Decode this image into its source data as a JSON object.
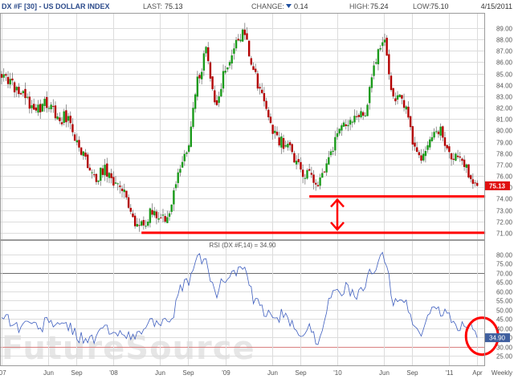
{
  "header": {
    "symbol": "DX #F [30] - US DOLLAR INDEX",
    "last_label": "LAST:",
    "last_value": "75.13",
    "change_label": "CHANGE:",
    "change_value": "0.14",
    "change_direction_icon": "down-triangle-icon",
    "high_label": "HIGH:",
    "high_value": "75.24",
    "low_label": "LOW:",
    "low_value": "75.10",
    "date": "4/15/2011"
  },
  "watermark": "FutureSource",
  "colors": {
    "up_candle": "#1a9a1a",
    "down_candle": "#b30000",
    "annotation": "#ff0000",
    "rsi_line": "#3f5fbf",
    "last_price_box": "#e01010",
    "rsi_value_box": "#3f5f9f"
  },
  "chart_data": [
    {
      "type": "candlestick",
      "title": "DX #F [30] - US DOLLAR INDEX",
      "interval_label": "Weekly",
      "x_tick_labels": [
        "'07",
        "Jun",
        "Sep",
        "'08",
        "Jun",
        "Sep",
        "'09",
        "Jun",
        "Sep",
        "'10",
        "Jun",
        "Sep",
        "'11",
        "Apr"
      ],
      "x_tick_dates": [
        "2007-01",
        "2007-06",
        "2007-09",
        "2008-01",
        "2008-06",
        "2008-09",
        "2009-01",
        "2009-06",
        "2009-09",
        "2010-01",
        "2010-06",
        "2010-09",
        "2011-01",
        "2011-04"
      ],
      "ylim": [
        70.5,
        90.2
      ],
      "y_ticks": [
        71.0,
        72.0,
        73.0,
        74.0,
        75.0,
        76.0,
        77.0,
        78.0,
        79.0,
        80.0,
        81.0,
        82.0,
        83.0,
        84.0,
        85.0,
        86.0,
        87.0,
        88.0,
        89.0
      ],
      "y_tick_labels": [
        "71.00",
        "72.00",
        "73.00",
        "74.00",
        "75.00",
        "76.00",
        "77.00",
        "78.00",
        "79.00",
        "80.00",
        "81.00",
        "82.00",
        "83.00",
        "84.00",
        "85.00",
        "86.00",
        "87.00",
        "88.00",
        "89.00"
      ],
      "approx_close_path": [
        [
          "2007-01",
          84.8
        ],
        [
          "2007-03",
          83.4
        ],
        [
          "2007-04",
          82.3
        ],
        [
          "2007-05",
          82.0
        ],
        [
          "2007-06",
          82.5
        ],
        [
          "2007-07",
          80.8
        ],
        [
          "2007-08",
          81.3
        ],
        [
          "2007-09",
          79.0
        ],
        [
          "2007-10",
          77.6
        ],
        [
          "2007-11",
          75.6
        ],
        [
          "2007-12",
          76.7
        ],
        [
          "2008-01",
          75.7
        ],
        [
          "2008-02",
          75.0
        ],
        [
          "2008-03",
          72.0
        ],
        [
          "2008-04",
          71.6
        ],
        [
          "2008-05",
          72.7
        ],
        [
          "2008-06",
          72.6
        ],
        [
          "2008-07",
          72.4
        ],
        [
          "2008-08",
          76.5
        ],
        [
          "2008-09",
          78.5
        ],
        [
          "2008-10",
          84.5
        ],
        [
          "2008-11",
          87.0
        ],
        [
          "2008-12",
          82.0
        ],
        [
          "2009-01",
          85.5
        ],
        [
          "2009-03",
          89.0
        ],
        [
          "2009-04",
          85.2
        ],
        [
          "2009-06",
          80.0
        ],
        [
          "2009-07",
          79.0
        ],
        [
          "2009-08",
          78.2
        ],
        [
          "2009-09",
          76.5
        ],
        [
          "2009-10",
          76.2
        ],
        [
          "2009-11",
          75.0
        ],
        [
          "2009-12",
          77.8
        ],
        [
          "2010-01",
          79.5
        ],
        [
          "2010-02",
          80.5
        ],
        [
          "2010-03",
          81.0
        ],
        [
          "2010-04",
          81.5
        ],
        [
          "2010-05",
          86.0
        ],
        [
          "2010-06",
          88.0
        ],
        [
          "2010-07",
          82.5
        ],
        [
          "2010-08",
          83.0
        ],
        [
          "2010-09",
          79.5
        ],
        [
          "2010-10",
          77.0
        ],
        [
          "2010-11",
          79.0
        ],
        [
          "2010-12",
          80.0
        ],
        [
          "2011-01",
          78.0
        ],
        [
          "2011-02",
          77.5
        ],
        [
          "2011-03",
          76.5
        ],
        [
          "2011-04",
          75.13
        ]
      ],
      "last_price_label": "75.13",
      "annotations": [
        {
          "kind": "horizontal_line",
          "y": 74.2,
          "from": "2009-10",
          "to": "2011-04"
        },
        {
          "kind": "horizontal_line",
          "y": 71.0,
          "from": "2008-04",
          "to": "2011-04"
        },
        {
          "kind": "double_arrow",
          "x": "2010-01",
          "from_y": 74.2,
          "to_y": 71.0
        }
      ]
    },
    {
      "type": "line",
      "title": "RSI (DX #F,14) = 34.90",
      "ylim": [
        20,
        82
      ],
      "y_ticks": [
        25,
        30,
        35,
        40,
        45,
        50,
        55,
        60,
        65,
        70,
        75,
        80
      ],
      "y_tick_labels": [
        "25.00",
        "30.00",
        "35.00",
        "40.00",
        "45.00",
        "50.00",
        "55.00",
        "60.00",
        "65.00",
        "70.00",
        "75.00",
        "80.00"
      ],
      "reference_lines": [
        70,
        30
      ],
      "approx_path": [
        [
          "2007-01",
          48
        ],
        [
          "2007-03",
          40
        ],
        [
          "2007-04",
          45
        ],
        [
          "2007-05",
          38
        ],
        [
          "2007-06",
          46
        ],
        [
          "2007-07",
          40
        ],
        [
          "2007-08",
          43
        ],
        [
          "2007-09",
          36
        ],
        [
          "2007-10",
          35
        ],
        [
          "2007-11",
          33
        ],
        [
          "2007-12",
          42
        ],
        [
          "2008-01",
          35
        ],
        [
          "2008-02",
          40
        ],
        [
          "2008-03",
          33
        ],
        [
          "2008-04",
          39
        ],
        [
          "2008-05",
          43
        ],
        [
          "2008-06",
          45
        ],
        [
          "2008-07",
          40
        ],
        [
          "2008-08",
          60
        ],
        [
          "2008-09",
          65
        ],
        [
          "2008-10",
          78
        ],
        [
          "2008-11",
          75
        ],
        [
          "2008-12",
          58
        ],
        [
          "2009-01",
          68
        ],
        [
          "2009-03",
          73
        ],
        [
          "2009-04",
          55
        ],
        [
          "2009-06",
          45
        ],
        [
          "2009-07",
          47
        ],
        [
          "2009-08",
          42
        ],
        [
          "2009-09",
          38
        ],
        [
          "2009-10",
          40
        ],
        [
          "2009-11",
          32
        ],
        [
          "2009-12",
          55
        ],
        [
          "2010-01",
          60
        ],
        [
          "2010-02",
          62
        ],
        [
          "2010-03",
          55
        ],
        [
          "2010-04",
          64
        ],
        [
          "2010-05",
          74
        ],
        [
          "2010-06",
          79
        ],
        [
          "2010-07",
          55
        ],
        [
          "2010-08",
          57
        ],
        [
          "2010-09",
          45
        ],
        [
          "2010-10",
          35
        ],
        [
          "2010-11",
          52
        ],
        [
          "2010-12",
          49
        ],
        [
          "2011-01",
          46
        ],
        [
          "2011-02",
          40
        ],
        [
          "2011-03",
          44
        ],
        [
          "2011-04",
          34.9
        ]
      ],
      "last_value_label": "34.90",
      "annotations": [
        {
          "kind": "ellipse",
          "x": "2011-04",
          "y": 34.9
        }
      ]
    }
  ]
}
